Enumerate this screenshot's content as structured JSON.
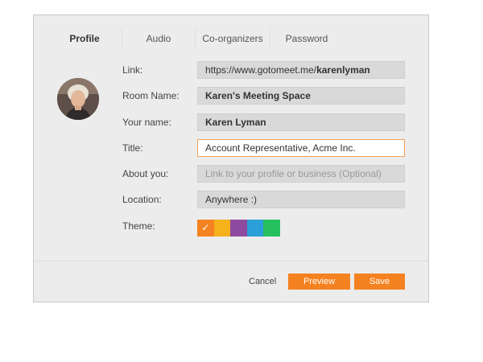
{
  "tabs": [
    {
      "label": "Profile",
      "active": true
    },
    {
      "label": "Audio",
      "active": false
    },
    {
      "label": "Co-organizers",
      "active": false
    },
    {
      "label": "Password",
      "active": false
    }
  ],
  "form": {
    "link": {
      "label": "Link:",
      "prefix": "https://www.gotomeet.me/",
      "username": "karenlyman"
    },
    "room_name": {
      "label": "Room Name:",
      "value": "Karen's Meeting Space"
    },
    "your_name": {
      "label": "Your name:",
      "value": "Karen Lyman"
    },
    "title": {
      "label": "Title:",
      "value": "Account Representative, Acme Inc."
    },
    "about_you": {
      "label": "About you:",
      "value": "",
      "placeholder": "Link to your profile or business (Optional)"
    },
    "location": {
      "label": "Location:",
      "value": "Anywhere :)"
    },
    "theme": {
      "label": "Theme:",
      "selected_index": 0,
      "selected_mark": "✓",
      "colors": [
        "#f58220",
        "#f5b21b",
        "#8e4a9e",
        "#2a9fd8",
        "#27c061"
      ]
    }
  },
  "actions": {
    "cancel_label": "Cancel",
    "preview_label": "Preview",
    "save_label": "Save"
  },
  "colors": {
    "accent": "#f58220",
    "focus_border": "#f5a259"
  },
  "icons": {
    "avatar": "user-avatar-photo",
    "theme_selected": "check-icon"
  }
}
